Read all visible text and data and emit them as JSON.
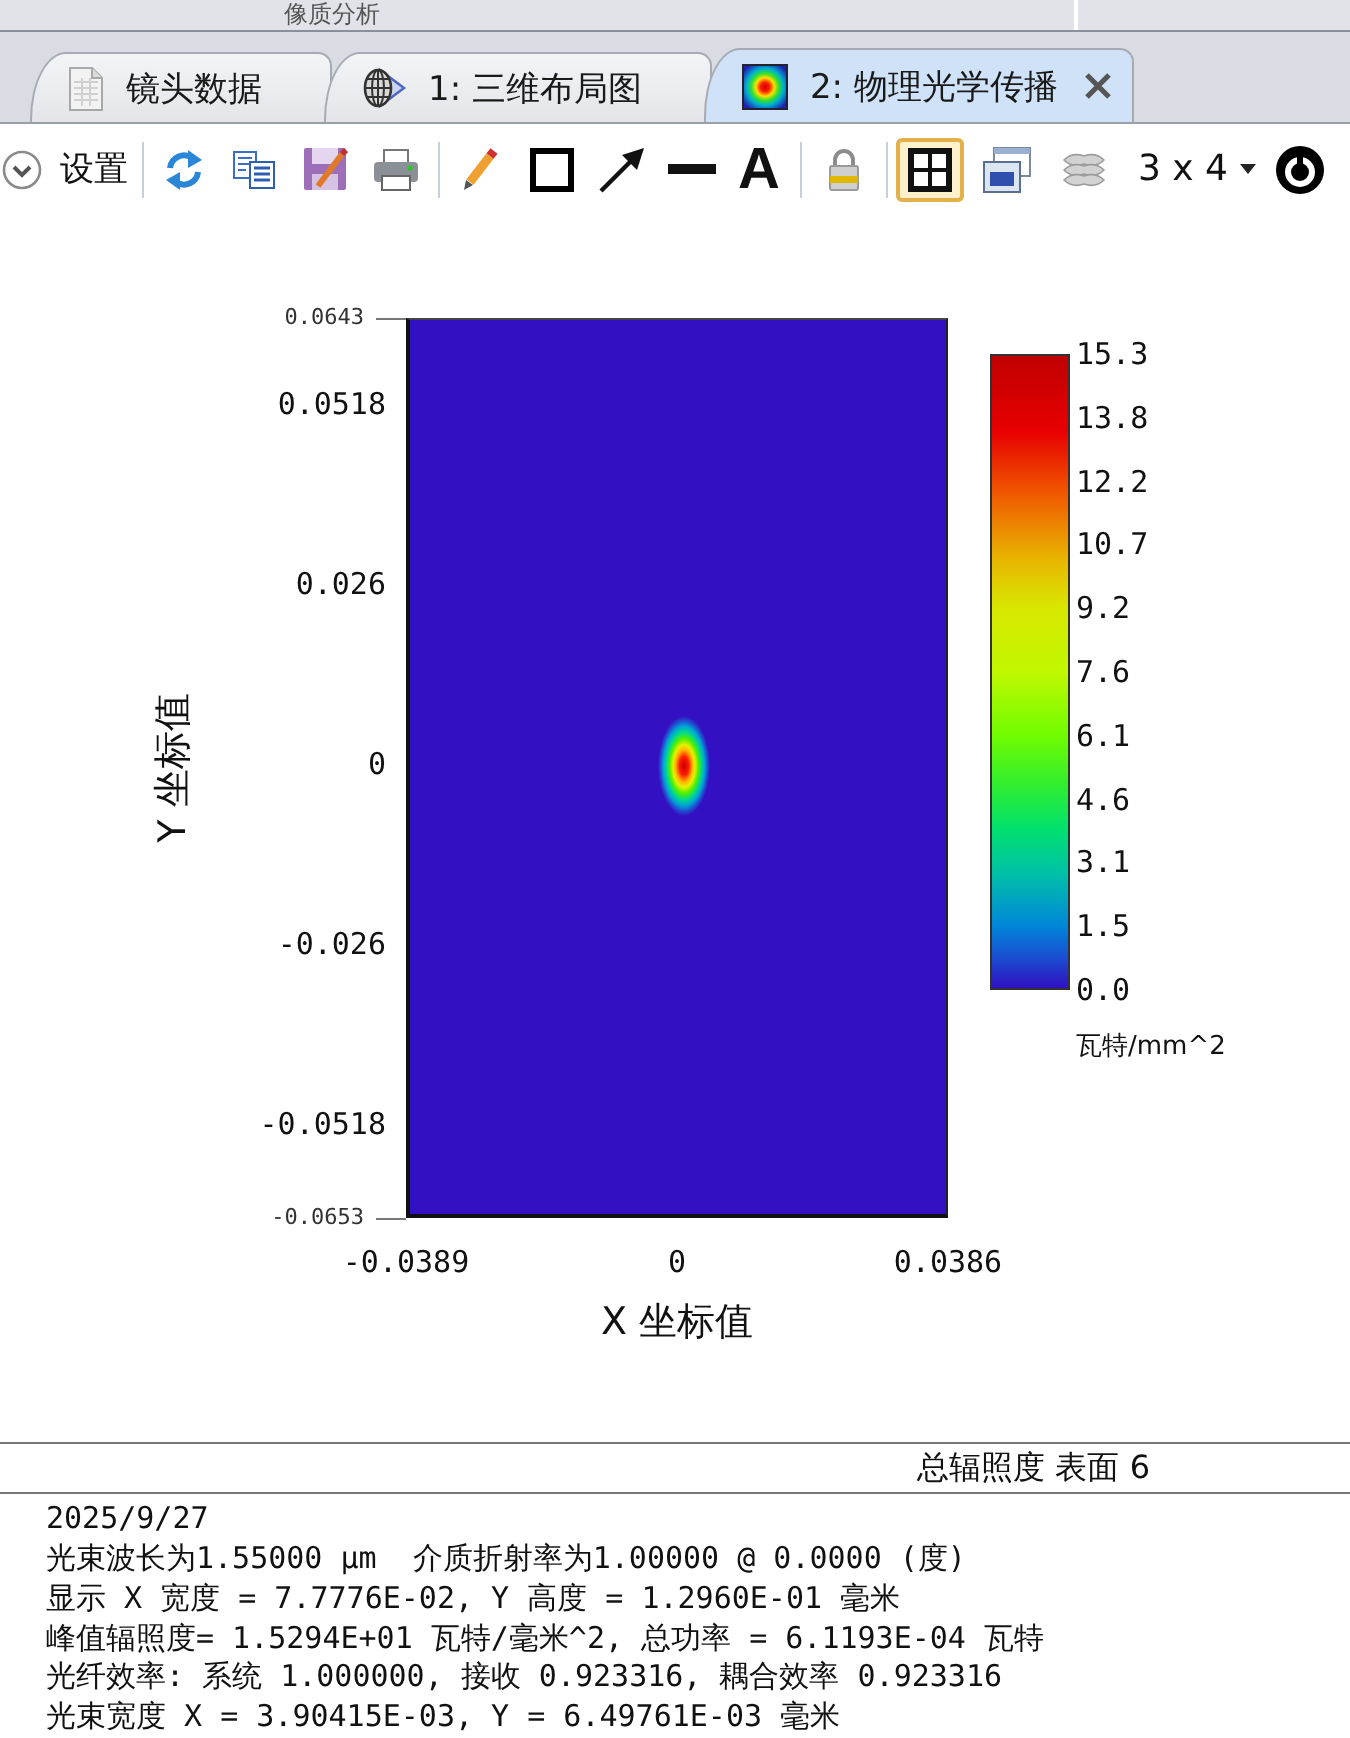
{
  "top_panel": {
    "title": "像质分析"
  },
  "tabs": [
    {
      "label": "镜头数据",
      "kind": "document",
      "selected": false
    },
    {
      "label": "1: 三维布局图",
      "kind": "layout",
      "selected": false
    },
    {
      "label": "2: 物理光学传播",
      "kind": "analysis",
      "selected": true
    }
  ],
  "toolbar": {
    "settings_label": "设置",
    "text_tool_glyph": "A",
    "grid_view": {
      "selected": true
    },
    "window_view": {
      "selected": false
    },
    "layers_button": {
      "disabled": true
    },
    "layout_button": {
      "label": "3 x 4"
    }
  },
  "plot": {
    "y_end_ticks": [
      "0.0643",
      "-0.0653"
    ],
    "y_ticks": [
      "0.0518",
      "0.026",
      "0",
      "-0.026",
      "-0.0518"
    ],
    "x_ticks": [
      "-0.0389",
      "0",
      "0.0386"
    ],
    "xlabel": "X 坐标值",
    "ylabel": "Y 坐标值",
    "colorbar": {
      "ticks": [
        "15.3",
        "13.8",
        "12.2",
        "10.7",
        "9.2",
        "7.6",
        "6.1",
        "4.6",
        "3.1",
        "1.5",
        "0.0"
      ],
      "unit": "瓦特/mm^2"
    }
  },
  "summary": {
    "title": "总辐照度 表面 6",
    "lines": [
      "2025/9/27",
      "光束波长为1.55000 µm  介质折射率为1.00000 @ 0.0000 (度)",
      "显示 X 宽度 = 7.7776E-02, Y 高度 = 1.2960E-01 毫米",
      "峰值辐照度= 1.5294E+01 瓦特/毫米^2, 总功率 = 6.1193E-04 瓦特",
      "光纤效率: 系统 1.000000, 接收 0.923316, 耦合效率 0.923316",
      "光束宽度 X = 3.90415E-03, Y = 6.49761E-03 毫米"
    ]
  }
}
